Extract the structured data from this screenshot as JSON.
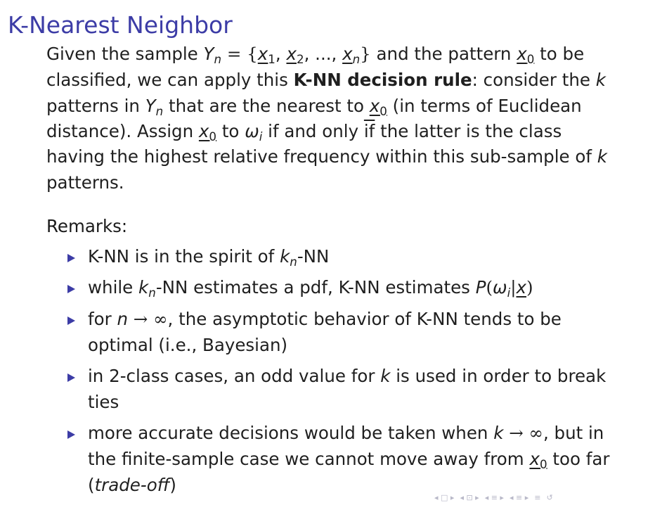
{
  "slide": {
    "title": "K-Nearest Neighbor",
    "para": {
      "l1_a": "Given the sample ",
      "l1_Y": "Y",
      "l1_n": "n",
      "l1_eq": " = {",
      "l1_x1": "x",
      "l1_1": "1",
      "l1_c1": ", ",
      "l1_x2": "x",
      "l1_2": "2",
      "l1_c2": ", ..., ",
      "l1_xn": "x",
      "l1_nn": "n",
      "l1_close": "}",
      "l1_b": " and the pattern ",
      "l1_x0": "x",
      "l1_0": "0",
      "l1_c": " to be",
      "l2_a": "classified, we can apply this ",
      "l2_bold": "K-NN decision rule",
      "l2_b": ": consider the ",
      "l2_k": "k",
      "l3_a": "patterns in ",
      "l3_Y": "Y",
      "l3_n": "n",
      "l3_b": " that are the nearest to ",
      "l3_x0": "x",
      "l3_0": "0",
      "l3_c": " (in terms of Euclidean",
      "l4_a": "distance). Assign ",
      "l4_x0": "x",
      "l4_0": "0",
      "l4_b": " to ",
      "l4_w": "ω",
      "l4_i": "i",
      "l4_c": " if and only ",
      "l4_if": "if",
      "l4_d": " the latter is the class",
      "l5_a": "having the highest relative frequency within this sub-sample of ",
      "l5_k": "k",
      "l6": "patterns."
    },
    "remarks_label": "Remarks:",
    "remarks": {
      "r1_a": "K-NN is in the spirit of ",
      "r1_k": "k",
      "r1_n": "n",
      "r1_b": "-NN",
      "r2_a": "while ",
      "r2_k": "k",
      "r2_n": "n",
      "r2_b": "-NN estimates a pdf, K-NN estimates ",
      "r2_P": "P",
      "r2_open": "(",
      "r2_w": "ω",
      "r2_i": "i",
      "r2_bar": "|",
      "r2_x": "x",
      "r2_close": ")",
      "r3_a": "for ",
      "r3_n": "n",
      "r3_arrow": " → ∞",
      "r3_b": ", the asymptotic behavior of K-NN tends to be",
      "r3_l2": "optimal (i.e., Bayesian)",
      "r4_a": "in 2-class cases, an odd value for ",
      "r4_k": "k",
      "r4_b": " is used in order to break",
      "r4_l2": "ties",
      "r5_a": "more accurate decisions would be taken when ",
      "r5_k": "k",
      "r5_arrow": " → ∞",
      "r5_b": ", but in",
      "r5_l2_a": "the finite-sample case we cannot move away from ",
      "r5_x0": "x",
      "r5_0": "0",
      "r5_l2_b": " too far",
      "r5_l3_open": "(",
      "r5_l3_it": "trade-off",
      "r5_l3_close": ")"
    },
    "nav": {
      "g1": "◂ □ ▸",
      "g2": "◂ ⊡ ▸",
      "g3": "◂ ≡ ▸",
      "g4": "◂ ≡ ▸",
      "g5": "≡",
      "g6": "↺"
    },
    "colors": {
      "title": "#3c3ca6",
      "bullet": "#3c3ca6",
      "text": "#1f1f1f",
      "nav": "#b8b8c8"
    }
  }
}
